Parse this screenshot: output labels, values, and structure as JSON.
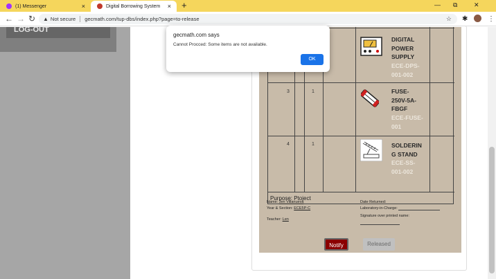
{
  "browser": {
    "tabs": [
      {
        "title": "(1) Messenger",
        "close": "×"
      },
      {
        "title": "Digital Borrowing System",
        "close": "×"
      }
    ],
    "new_tab": "+",
    "window_controls": {
      "minimize": "—",
      "restore": "⧉",
      "close": "✕"
    },
    "nav": {
      "back": "←",
      "forward": "→",
      "reload": "↻"
    },
    "security_label": "Not secure",
    "url": "gecmath.com/tup-dbs/index.php?page=to-release",
    "star": "☆",
    "extensions": "✱",
    "menu": "⋮"
  },
  "sidebar": {
    "logout_label": "LOG-OUT"
  },
  "items": [
    {
      "no": "",
      "qty": "",
      "name_lines": [
        "DIGITAL",
        "POWER",
        "SUPPLY"
      ],
      "code_lines": [
        "ECE-DPS-",
        "001-002"
      ]
    },
    {
      "no": "3",
      "qty": "1",
      "name_lines": [
        "FUSE-",
        "250V-5A-",
        "FBGF"
      ],
      "code_lines": [
        "ECE-FUSE-",
        "001"
      ]
    },
    {
      "no": "4",
      "qty": "1",
      "name_lines": [
        "SOLDERIN",
        "G STAND"
      ],
      "code_lines": [
        "ECE-SS-",
        "001-002"
      ]
    }
  ],
  "purpose": "Purpose: Ptoject",
  "borrower": {
    "name_label": "Name:",
    "name": "Jen Villanueva",
    "section_label": "Year & Section:",
    "section": "ECE5P-C",
    "teacher_label": "Teacher:",
    "teacher": "Len",
    "date_returned_label": "Date Returned:",
    "lab_label": "Laboratory-in-Charge:",
    "signature_label": "Signature over printed name:"
  },
  "actions": {
    "notify": "Notify",
    "released": "Released"
  },
  "dialog": {
    "title": "gecmath.com says",
    "message": "Cannot Procced: Some items are not available.",
    "ok": "OK"
  },
  "colors": {
    "accent": "#1a73e8",
    "notify": "#8b0000",
    "tabstrip": "#f5d65c",
    "paper": "#c8bba9"
  }
}
